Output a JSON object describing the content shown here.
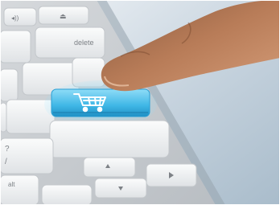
{
  "photo": {
    "keys": {
      "volume": "◂))",
      "eject": "⏏",
      "delete": "delete",
      "alt": "alt",
      "question": "?",
      "slash": "/"
    },
    "cart_key": {
      "icon": "shopping-cart-icon",
      "color": "#3fb7e6"
    },
    "colors": {
      "background": "#c9d6e0",
      "keyboard": "#cfd3d7",
      "key": "#eef0f2",
      "skin": "#c98e6a"
    }
  }
}
